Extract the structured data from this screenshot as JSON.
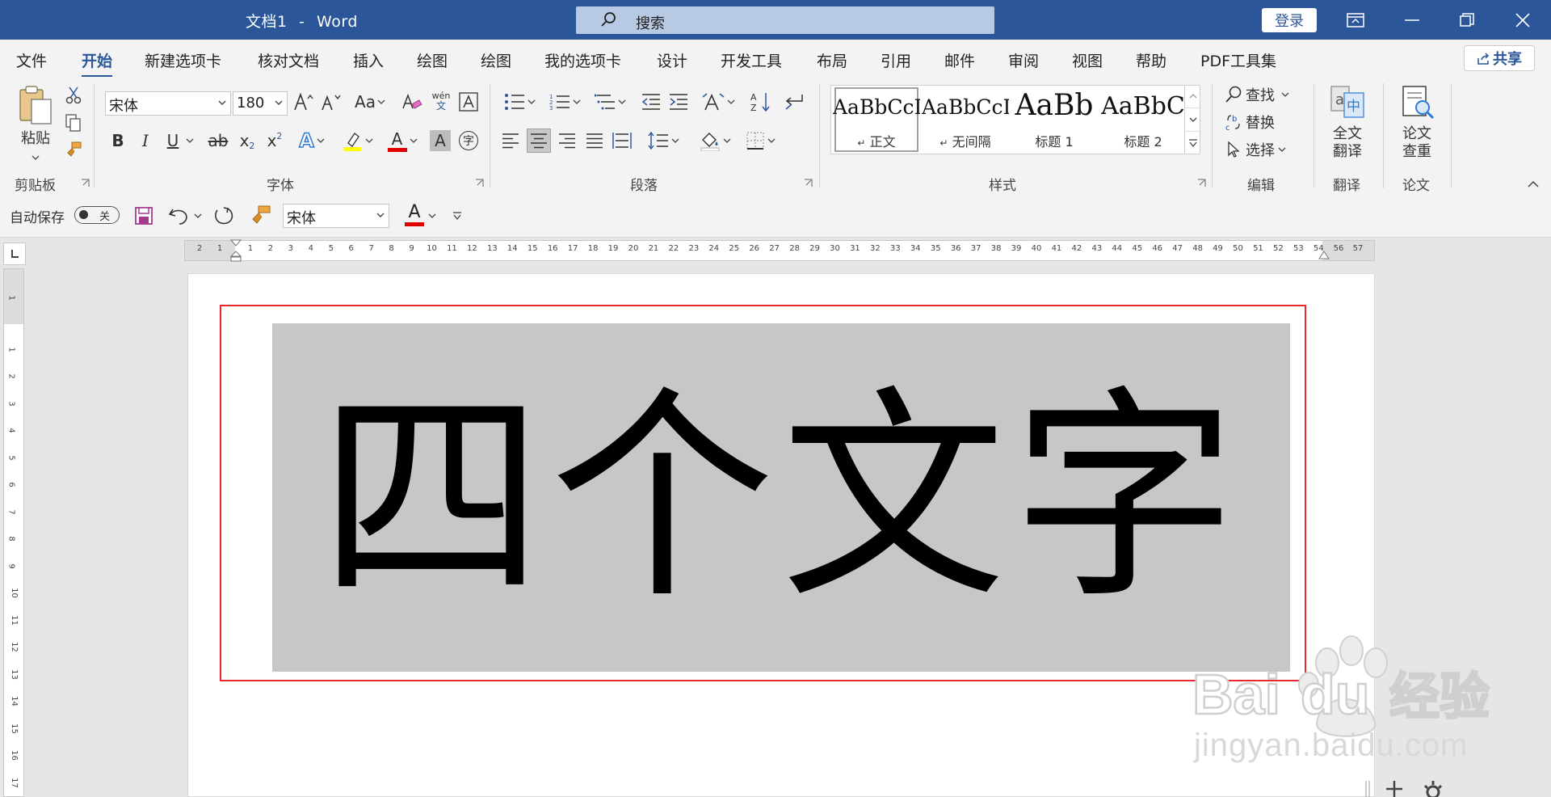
{
  "titlebar": {
    "doc_name": "文档1",
    "separator": "-",
    "app_name": "Word",
    "search_placeholder": "搜索",
    "login_label": "登录",
    "bg_color": "#2b579a"
  },
  "menu": {
    "tabs": [
      "文件",
      "开始",
      "新建选项卡",
      "核对文档",
      "插入",
      "绘图",
      "绘图",
      "我的选项卡",
      "设计",
      "开发工具",
      "布局",
      "引用",
      "邮件",
      "审阅",
      "视图",
      "帮助",
      "PDF工具集"
    ],
    "active_index": 1,
    "share_label": "共享"
  },
  "ribbon": {
    "clipboard": {
      "paste_label": "粘贴",
      "group_label": "剪贴板"
    },
    "font": {
      "font_name": "宋体",
      "font_size": "180",
      "group_label": "字体",
      "case_label": "Aa",
      "phonetic_top": "wén",
      "phonetic_bottom": "文",
      "bold": "B",
      "italic": "I",
      "underline": "U",
      "strike": "ab",
      "subscript": "x",
      "superscript": "x",
      "text_effect": "A",
      "font_color": "A",
      "char_shade": "A",
      "enclose": "字"
    },
    "paragraph": {
      "group_label": "段落"
    },
    "styles": {
      "group_label": "样式",
      "items": [
        {
          "sample": "AaBbCcI",
          "name": "正文",
          "mark": "↵"
        },
        {
          "sample": "AaBbCcI",
          "name": "无间隔",
          "mark": "↵"
        },
        {
          "sample": "AaBb",
          "name": "标题 1"
        },
        {
          "sample": "AaBbC",
          "name": "标题 2"
        }
      ],
      "selected_index": 0
    },
    "editing": {
      "find": "查找",
      "replace": "替换",
      "select": "选择",
      "group_label": "编辑"
    },
    "translate": {
      "button_line1": "全文",
      "button_line2": "翻译",
      "group_label": "翻译"
    },
    "thesis": {
      "button_line1": "论文",
      "button_line2": "查重",
      "group_label": "论文"
    }
  },
  "qat": {
    "autosave_label": "自动保存",
    "autosave_state": "关",
    "font_name": "宋体",
    "font_color_letter": "A"
  },
  "document": {
    "text": "四个文字",
    "font_size_pt": 180,
    "shading_color": "#c7c7c7",
    "highlight_box_color": "#e8282c"
  },
  "rulers": {
    "h_negative": [
      "2",
      "1"
    ],
    "h_ticks": [
      "1",
      "2",
      "3",
      "4",
      "5",
      "6",
      "7",
      "8",
      "9",
      "10",
      "11",
      "12",
      "13",
      "14",
      "15",
      "16",
      "17",
      "18",
      "19",
      "20",
      "21",
      "22",
      "23",
      "24",
      "25",
      "26",
      "27",
      "28",
      "29",
      "30",
      "31",
      "32",
      "33",
      "34",
      "35",
      "36",
      "37",
      "38",
      "39",
      "40",
      "41",
      "42",
      "43",
      "44",
      "45",
      "46",
      "47",
      "48",
      "49",
      "50",
      "51",
      "52",
      "53",
      "54"
    ],
    "h_right": [
      "56",
      "57"
    ],
    "v_ticks": [
      "1",
      "1",
      "2",
      "3",
      "4",
      "5",
      "6",
      "7",
      "8",
      "9",
      "10",
      "11",
      "12",
      "13",
      "14",
      "15",
      "16",
      "17"
    ]
  },
  "watermark": {
    "brand": "Bai",
    "brand_tail": "du",
    "suffix": "经验",
    "url": "jingyan.baidu.com"
  }
}
